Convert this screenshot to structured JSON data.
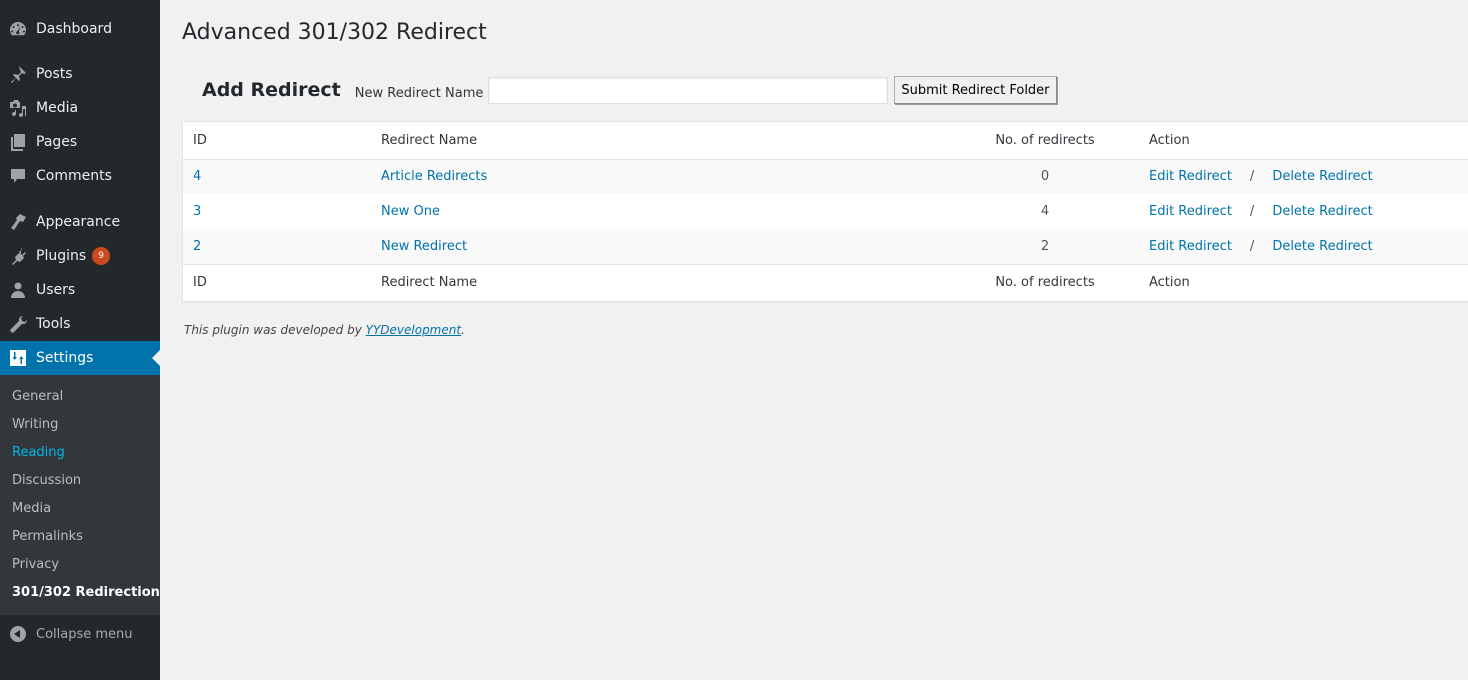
{
  "sidebar": {
    "items": [
      {
        "label": "Dashboard",
        "icon": "dashboard-icon"
      },
      {
        "label": "Posts",
        "icon": "pin-icon"
      },
      {
        "label": "Media",
        "icon": "media-icon"
      },
      {
        "label": "Pages",
        "icon": "pages-icon"
      },
      {
        "label": "Comments",
        "icon": "comment-icon"
      },
      {
        "label": "Appearance",
        "icon": "paintbrush-icon"
      },
      {
        "label": "Plugins",
        "icon": "plugin-icon",
        "badge": "9"
      },
      {
        "label": "Users",
        "icon": "user-icon"
      },
      {
        "label": "Tools",
        "icon": "wrench-icon"
      },
      {
        "label": "Settings",
        "icon": "settings-sliders-icon",
        "active": true
      }
    ],
    "submenu": [
      {
        "label": "General"
      },
      {
        "label": "Writing"
      },
      {
        "label": "Reading"
      },
      {
        "label": "Discussion"
      },
      {
        "label": "Media"
      },
      {
        "label": "Permalinks"
      },
      {
        "label": "Privacy"
      },
      {
        "label": "301/302 Redirection"
      }
    ],
    "collapse_label": "Collapse menu"
  },
  "page": {
    "title": "Advanced 301/302 Redirect"
  },
  "add_form": {
    "heading": "Add Redirect",
    "name_label": "New Redirect Name",
    "name_value": "",
    "name_placeholder": "",
    "submit_label": "Submit Redirect Folder"
  },
  "table": {
    "columns": [
      "ID",
      "Redirect Name",
      "No. of redirects",
      "Action"
    ],
    "rows": [
      {
        "id": "4",
        "name": "Article Redirects",
        "count": "0",
        "edit": "Edit Redirect",
        "sep": "/",
        "delete": "Delete Redirect"
      },
      {
        "id": "3",
        "name": "New One",
        "count": "4",
        "edit": "Edit Redirect",
        "sep": "/",
        "delete": "Delete Redirect"
      },
      {
        "id": "2",
        "name": "New Redirect",
        "count": "2",
        "edit": "Edit Redirect",
        "sep": "/",
        "delete": "Delete Redirect"
      }
    ]
  },
  "footer": {
    "prefix": "This plugin was developed by ",
    "link_text": "YYDevelopment",
    "suffix": "."
  },
  "colors": {
    "sidebar_bg": "#23282d",
    "submenu_bg": "#32373c",
    "accent": "#0073aa",
    "current_submenu": "#00b9eb",
    "badge": "#ca4a1f"
  }
}
